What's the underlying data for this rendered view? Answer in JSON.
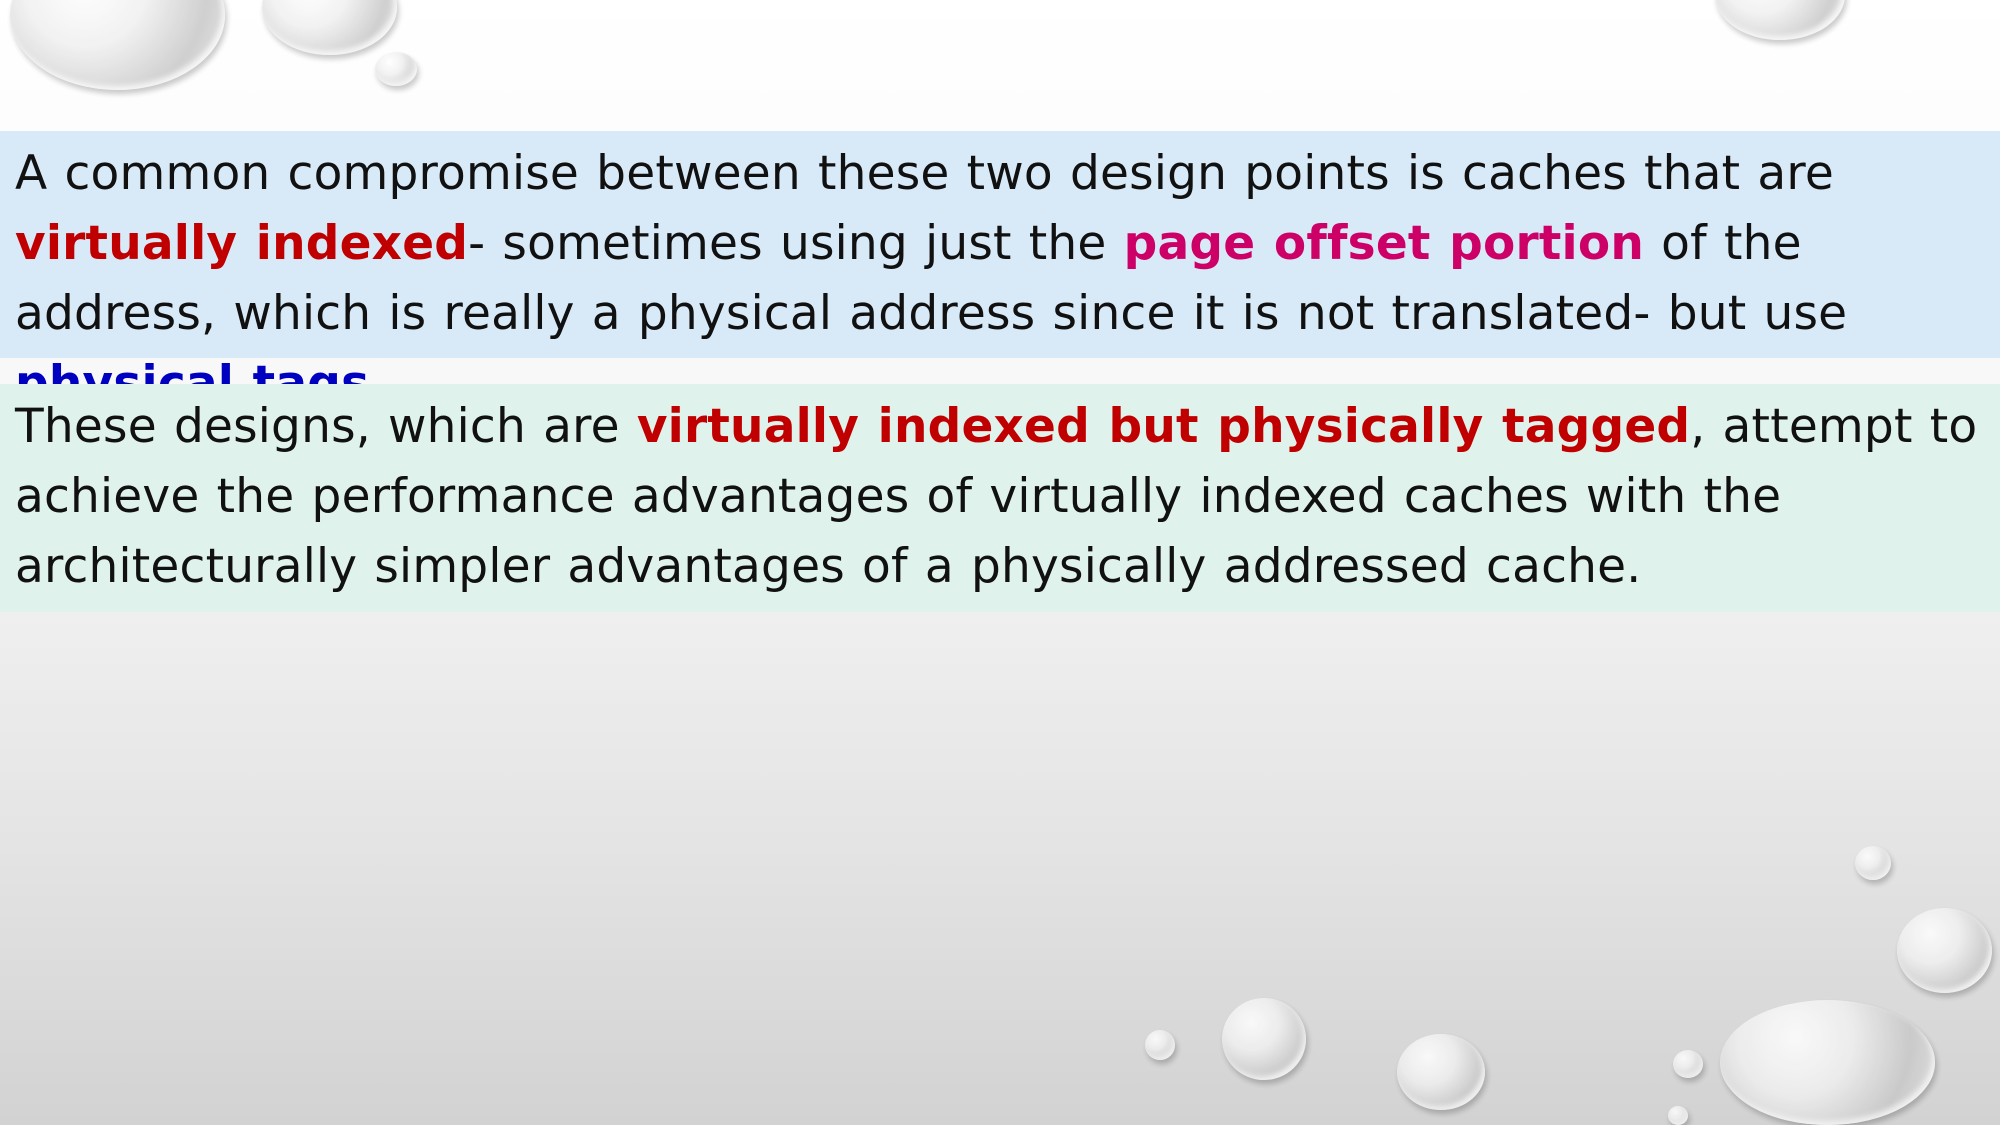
{
  "paragraph1": {
    "text_a": "A common compromise between these two design points is caches that are ",
    "hl_virtually_indexed": "virtually indexed",
    "text_b": "- sometimes using just the ",
    "hl_page_offset": "page offset portion",
    "text_c": " of the address, which is really a physical address since it is not translated- but use ",
    "hl_physical_tags": "physical tags",
    "text_d": "."
  },
  "paragraph2": {
    "text_a": "These designs, which are ",
    "hl_vipt": "virtually indexed but physically tagged",
    "text_b": ", attempt to achieve the performance advantages of virtually indexed caches with the architecturally simpler advantages of a physically addressed cache."
  },
  "colors": {
    "emphasis_red": "#c00000",
    "emphasis_magenta": "#cc0066",
    "emphasis_blue": "#0000c0",
    "para1_background": "#d8e9f7",
    "para2_background": "#dff3ec"
  }
}
